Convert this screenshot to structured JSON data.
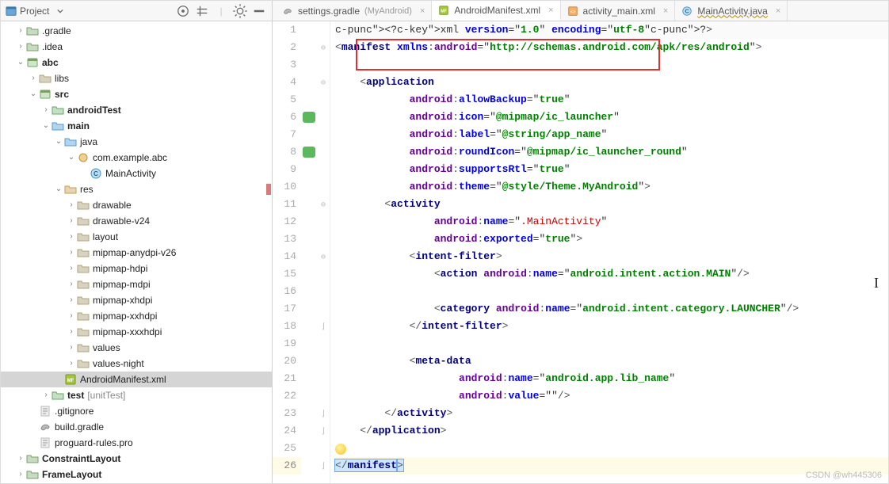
{
  "project_header": {
    "title": "Project",
    "dropdown_icon": "chevron-down"
  },
  "tree": [
    {
      "d": 0,
      "tw": ">",
      "icon": "folder-open",
      "label": ".gradle"
    },
    {
      "d": 0,
      "tw": ">",
      "icon": "folder-open",
      "label": ".idea"
    },
    {
      "d": 0,
      "tw": "v",
      "icon": "module",
      "label": "abc",
      "bold": true
    },
    {
      "d": 1,
      "tw": ">",
      "icon": "folder",
      "label": "libs"
    },
    {
      "d": 1,
      "tw": "v",
      "icon": "module",
      "label": "src",
      "bold": true
    },
    {
      "d": 2,
      "tw": ">",
      "icon": "folder-test",
      "label": "androidTest",
      "bold": true
    },
    {
      "d": 2,
      "tw": "v",
      "icon": "folder-src",
      "label": "main",
      "bold": true
    },
    {
      "d": 3,
      "tw": "v",
      "icon": "folder-src",
      "label": "java"
    },
    {
      "d": 4,
      "tw": "v",
      "icon": "package",
      "label": "com.example.abc"
    },
    {
      "d": 5,
      "tw": "",
      "icon": "class",
      "label": "MainActivity"
    },
    {
      "d": 3,
      "tw": "v",
      "icon": "folder-res",
      "label": "res"
    },
    {
      "d": 4,
      "tw": ">",
      "icon": "folder",
      "label": "drawable"
    },
    {
      "d": 4,
      "tw": ">",
      "icon": "folder",
      "label": "drawable-v24"
    },
    {
      "d": 4,
      "tw": ">",
      "icon": "folder",
      "label": "layout"
    },
    {
      "d": 4,
      "tw": ">",
      "icon": "folder",
      "label": "mipmap-anydpi-v26"
    },
    {
      "d": 4,
      "tw": ">",
      "icon": "folder",
      "label": "mipmap-hdpi"
    },
    {
      "d": 4,
      "tw": ">",
      "icon": "folder",
      "label": "mipmap-mdpi"
    },
    {
      "d": 4,
      "tw": ">",
      "icon": "folder",
      "label": "mipmap-xhdpi"
    },
    {
      "d": 4,
      "tw": ">",
      "icon": "folder",
      "label": "mipmap-xxhdpi"
    },
    {
      "d": 4,
      "tw": ">",
      "icon": "folder",
      "label": "mipmap-xxxhdpi"
    },
    {
      "d": 4,
      "tw": ">",
      "icon": "folder",
      "label": "values"
    },
    {
      "d": 4,
      "tw": ">",
      "icon": "folder",
      "label": "values-night"
    },
    {
      "d": 3,
      "tw": "",
      "icon": "manifest",
      "label": "AndroidManifest.xml",
      "selected": true
    },
    {
      "d": 2,
      "tw": ">",
      "icon": "folder-test",
      "label": "test",
      "bold": true,
      "suffix": "[unitTest]"
    },
    {
      "d": 1,
      "tw": "",
      "icon": "gitignore",
      "label": ".gitignore"
    },
    {
      "d": 1,
      "tw": "",
      "icon": "gradle",
      "label": "build.gradle"
    },
    {
      "d": 1,
      "tw": "",
      "icon": "proguard",
      "label": "proguard-rules.pro"
    },
    {
      "d": 0,
      "tw": ">",
      "icon": "folder-open",
      "label": "ConstraintLayout",
      "bold": true
    },
    {
      "d": 0,
      "tw": ">",
      "icon": "folder-open",
      "label": "FrameLayout",
      "bold": true
    }
  ],
  "tabs": [
    {
      "icon": "gradle",
      "label": "settings.gradle",
      "suffix": "(MyAndroid)",
      "close": true
    },
    {
      "icon": "manifest",
      "label": "AndroidManifest.xml",
      "close": true,
      "active": true
    },
    {
      "icon": "xml",
      "label": "activity_main.xml",
      "close": true
    },
    {
      "icon": "class",
      "label": "MainActivity.java",
      "close": true,
      "wavy": true
    }
  ],
  "code": {
    "lines": [
      {
        "n": 1,
        "txt": "<?xml version=\"1.0\" encoding=\"utf-8\"?>",
        "hl": true
      },
      {
        "n": 2,
        "txt": "<manifest xmlns:android=\"http://schemas.android.com/apk/res/android\">"
      },
      {
        "n": 3,
        "txt": ""
      },
      {
        "n": 4,
        "txt": "    <application"
      },
      {
        "n": 5,
        "txt": "            android:allowBackup=\"true\""
      },
      {
        "n": 6,
        "txt": "            android:icon=\"@mipmap/ic_launcher\"",
        "mark": true
      },
      {
        "n": 7,
        "txt": "            android:label=\"@string/app_name\""
      },
      {
        "n": 8,
        "txt": "            android:roundIcon=\"@mipmap/ic_launcher_round\"",
        "mark": true
      },
      {
        "n": 9,
        "txt": "            android:supportsRtl=\"true\""
      },
      {
        "n": 10,
        "txt": "            android:theme=\"@style/Theme.MyAndroid\">"
      },
      {
        "n": 11,
        "txt": "        <activity"
      },
      {
        "n": 12,
        "txt": "                android:name=\".MainActivity\""
      },
      {
        "n": 13,
        "txt": "                android:exported=\"true\">"
      },
      {
        "n": 14,
        "txt": "            <intent-filter>"
      },
      {
        "n": 15,
        "txt": "                <action android:name=\"android.intent.action.MAIN\"/>"
      },
      {
        "n": 16,
        "txt": ""
      },
      {
        "n": 17,
        "txt": "                <category android:name=\"android.intent.category.LAUNCHER\"/>"
      },
      {
        "n": 18,
        "txt": "            </intent-filter>"
      },
      {
        "n": 19,
        "txt": ""
      },
      {
        "n": 20,
        "txt": "            <meta-data"
      },
      {
        "n": 21,
        "txt": "                    android:name=\"android.app.lib_name\""
      },
      {
        "n": 22,
        "txt": "                    android:value=\"\"/>"
      },
      {
        "n": 23,
        "txt": "        </activity>"
      },
      {
        "n": 24,
        "txt": "    </application>"
      },
      {
        "n": 25,
        "txt": ""
      },
      {
        "n": 26,
        "txt": "</manifest>",
        "cur": true
      }
    ]
  },
  "watermark": "CSDN @wh445306"
}
